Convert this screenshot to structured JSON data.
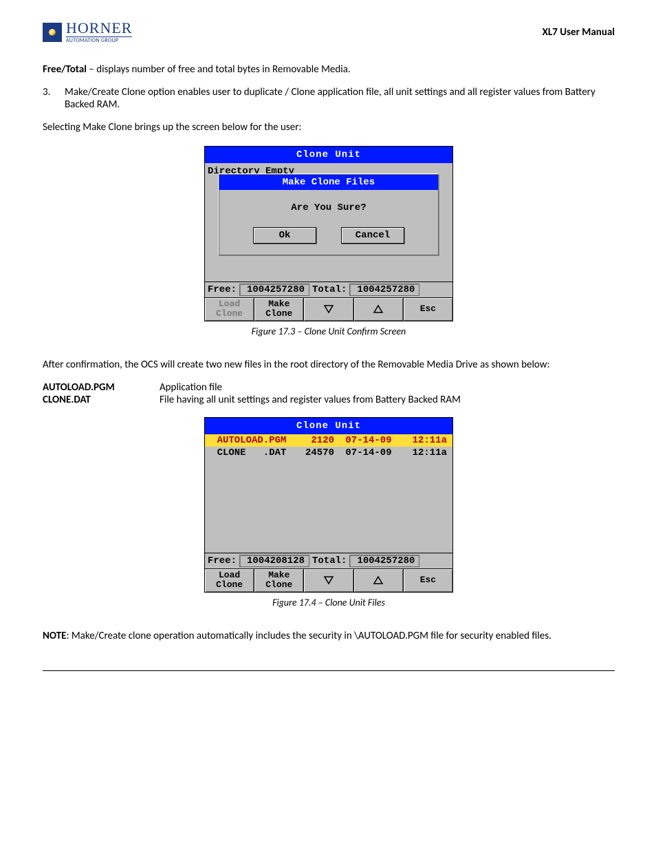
{
  "header": {
    "brand": "HORNER",
    "tagline": "AUTOMATION GROUP",
    "doc_title": "XL7 User Manual"
  },
  "body": {
    "free_total_label": "Free/Total",
    "free_total_desc": " – displays number of free and total bytes in Removable Media.",
    "item3_num": "3.",
    "item3_text": "Make/Create Clone option enables user to duplicate / Clone application file, all unit settings and all register values from Battery Backed RAM.",
    "select_text": "Selecting Make Clone brings up the screen below for the user:",
    "after_confirm": "After confirmation, the OCS will create two new files in the root directory of the Removable Media Drive as shown below:",
    "note_label": "NOTE",
    "note_text": ": Make/Create clone operation automatically includes the security in \\AUTOLOAD.PGM file for security enabled files."
  },
  "screen1": {
    "title": "Clone Unit",
    "dir_empty": "Directory Empty",
    "dlg_title": "Make Clone Files",
    "dlg_prompt": "Are You Sure?",
    "ok": "Ok",
    "cancel": "Cancel",
    "free_label": "Free:",
    "free_value": "1004257280",
    "total_label": "Total:",
    "total_value": "1004257280",
    "btn_load": "Load\nClone",
    "btn_make": "Make\nClone",
    "btn_esc": "Esc",
    "caption": "Figure 17.3 – Clone Unit Confirm Screen"
  },
  "file_desc": {
    "f1_name": "AUTOLOAD.PGM",
    "f1_desc": "Application file",
    "f2_name": "CLONE.DAT",
    "f2_desc": "File having all unit settings and register values from Battery Backed RAM"
  },
  "screen2": {
    "title": "Clone Unit",
    "rows": [
      {
        "name": "AUTOLOAD.PGM",
        "size": "2120",
        "date": "07-14-09",
        "time": "12:11a",
        "sel": true
      },
      {
        "name": "CLONE   .DAT",
        "size": "24570",
        "date": "07-14-09",
        "time": "12:11a",
        "sel": false
      }
    ],
    "free_label": "Free:",
    "free_value": "1004208128",
    "total_label": "Total:",
    "total_value": "1004257280",
    "btn_load": "Load\nClone",
    "btn_make": "Make\nClone",
    "btn_esc": "Esc",
    "caption": "Figure 17.4 – Clone Unit Files"
  }
}
